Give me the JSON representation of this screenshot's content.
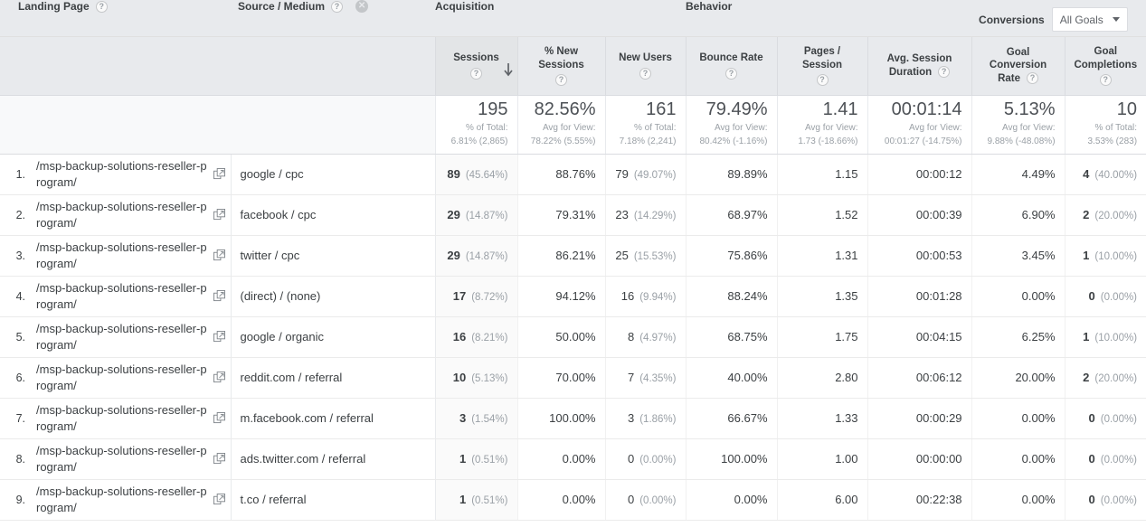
{
  "groups": {
    "acquisition": "Acquisition",
    "behavior": "Behavior",
    "conversions": "Conversions",
    "goals_select_value": "All Goals"
  },
  "dimensions": {
    "primary": "Landing Page",
    "secondary": "Source / Medium"
  },
  "metrics": {
    "sessions": "Sessions",
    "pct_new_sessions": "% New Sessions",
    "new_users": "New Users",
    "bounce_rate": "Bounce Rate",
    "pages_per_session": "Pages / Session",
    "avg_session_duration_l1": "Avg. Session",
    "avg_session_duration_l2": "Duration",
    "goal_conversion_rate_l1": "Goal Conversion",
    "goal_conversion_rate_l2": "Rate",
    "goal_completions_l1": "Goal",
    "goal_completions_l2": "Completions"
  },
  "icons": {
    "help": "?",
    "remove_secondary_dimension": "✕",
    "sort_descending": "sort-descending-arrow",
    "open_in_new": "open-in-new-window"
  },
  "totals": {
    "sessions": {
      "value": "195",
      "sub1": "% of Total:",
      "sub2": "6.81% (2,865)"
    },
    "pct_new": {
      "value": "82.56%",
      "sub1": "Avg for View:",
      "sub2": "78.22% (5.55%)"
    },
    "new_users": {
      "value": "161",
      "sub1": "% of Total:",
      "sub2": "7.18% (2,241)"
    },
    "bounce": {
      "value": "79.49%",
      "sub1": "Avg for View:",
      "sub2": "80.42% (-1.16%)"
    },
    "pages": {
      "value": "1.41",
      "sub1": "Avg for View:",
      "sub2": "1.73 (-18.66%)"
    },
    "duration": {
      "value": "00:01:14",
      "sub1": "Avg for View:",
      "sub2": "00:01:27 (-14.75%)"
    },
    "goal_rate": {
      "value": "5.13%",
      "sub1": "Avg for View:",
      "sub2": "9.88% (-48.08%)"
    },
    "goal_compl": {
      "value": "10",
      "sub1": "% of Total:",
      "sub2": "3.53% (283)"
    }
  },
  "rows": [
    {
      "index": "1.",
      "landing_page": "/msp-backup-solutions-reseller-program/",
      "source_medium": "google / cpc",
      "sessions": "89",
      "sessions_pct": "(45.64%)",
      "pct_new_sessions": "88.76%",
      "new_users": "79",
      "new_users_pct": "(49.07%)",
      "bounce_rate": "89.89%",
      "pages_per_session": "1.15",
      "avg_session_duration": "00:00:12",
      "goal_conversion_rate": "4.49%",
      "goal_completions": "4",
      "goal_completions_pct": "(40.00%)"
    },
    {
      "index": "2.",
      "landing_page": "/msp-backup-solutions-reseller-program/",
      "source_medium": "facebook / cpc",
      "sessions": "29",
      "sessions_pct": "(14.87%)",
      "pct_new_sessions": "79.31%",
      "new_users": "23",
      "new_users_pct": "(14.29%)",
      "bounce_rate": "68.97%",
      "pages_per_session": "1.52",
      "avg_session_duration": "00:00:39",
      "goal_conversion_rate": "6.90%",
      "goal_completions": "2",
      "goal_completions_pct": "(20.00%)"
    },
    {
      "index": "3.",
      "landing_page": "/msp-backup-solutions-reseller-program/",
      "source_medium": "twitter / cpc",
      "sessions": "29",
      "sessions_pct": "(14.87%)",
      "pct_new_sessions": "86.21%",
      "new_users": "25",
      "new_users_pct": "(15.53%)",
      "bounce_rate": "75.86%",
      "pages_per_session": "1.31",
      "avg_session_duration": "00:00:53",
      "goal_conversion_rate": "3.45%",
      "goal_completions": "1",
      "goal_completions_pct": "(10.00%)"
    },
    {
      "index": "4.",
      "landing_page": "/msp-backup-solutions-reseller-program/",
      "source_medium": "(direct) / (none)",
      "sessions": "17",
      "sessions_pct": "(8.72%)",
      "pct_new_sessions": "94.12%",
      "new_users": "16",
      "new_users_pct": "(9.94%)",
      "bounce_rate": "88.24%",
      "pages_per_session": "1.35",
      "avg_session_duration": "00:01:28",
      "goal_conversion_rate": "0.00%",
      "goal_completions": "0",
      "goal_completions_pct": "(0.00%)"
    },
    {
      "index": "5.",
      "landing_page": "/msp-backup-solutions-reseller-program/",
      "source_medium": "google / organic",
      "sessions": "16",
      "sessions_pct": "(8.21%)",
      "pct_new_sessions": "50.00%",
      "new_users": "8",
      "new_users_pct": "(4.97%)",
      "bounce_rate": "68.75%",
      "pages_per_session": "1.75",
      "avg_session_duration": "00:04:15",
      "goal_conversion_rate": "6.25%",
      "goal_completions": "1",
      "goal_completions_pct": "(10.00%)"
    },
    {
      "index": "6.",
      "landing_page": "/msp-backup-solutions-reseller-program/",
      "source_medium": "reddit.com / referral",
      "sessions": "10",
      "sessions_pct": "(5.13%)",
      "pct_new_sessions": "70.00%",
      "new_users": "7",
      "new_users_pct": "(4.35%)",
      "bounce_rate": "40.00%",
      "pages_per_session": "2.80",
      "avg_session_duration": "00:06:12",
      "goal_conversion_rate": "20.00%",
      "goal_completions": "2",
      "goal_completions_pct": "(20.00%)"
    },
    {
      "index": "7.",
      "landing_page": "/msp-backup-solutions-reseller-program/",
      "source_medium": "m.facebook.com / referral",
      "sessions": "3",
      "sessions_pct": "(1.54%)",
      "pct_new_sessions": "100.00%",
      "new_users": "3",
      "new_users_pct": "(1.86%)",
      "bounce_rate": "66.67%",
      "pages_per_session": "1.33",
      "avg_session_duration": "00:00:29",
      "goal_conversion_rate": "0.00%",
      "goal_completions": "0",
      "goal_completions_pct": "(0.00%)"
    },
    {
      "index": "8.",
      "landing_page": "/msp-backup-solutions-reseller-program/",
      "source_medium": "ads.twitter.com / referral",
      "sessions": "1",
      "sessions_pct": "(0.51%)",
      "pct_new_sessions": "0.00%",
      "new_users": "0",
      "new_users_pct": "(0.00%)",
      "bounce_rate": "100.00%",
      "pages_per_session": "1.00",
      "avg_session_duration": "00:00:00",
      "goal_conversion_rate": "0.00%",
      "goal_completions": "0",
      "goal_completions_pct": "(0.00%)"
    },
    {
      "index": "9.",
      "landing_page": "/msp-backup-solutions-reseller-program/",
      "source_medium": "t.co / referral",
      "sessions": "1",
      "sessions_pct": "(0.51%)",
      "pct_new_sessions": "0.00%",
      "new_users": "0",
      "new_users_pct": "(0.00%)",
      "bounce_rate": "0.00%",
      "pages_per_session": "6.00",
      "avg_session_duration": "00:22:38",
      "goal_conversion_rate": "0.00%",
      "goal_completions": "0",
      "goal_completions_pct": "(0.00%)"
    }
  ],
  "chart_data": {
    "type": "table",
    "title": "Landing Pages with Source / Medium secondary dimension",
    "columns": [
      "Landing Page",
      "Source / Medium",
      "Sessions",
      "% New Sessions",
      "New Users",
      "Bounce Rate",
      "Pages / Session",
      "Avg. Session Duration",
      "Goal Conversion Rate",
      "Goal Completions"
    ],
    "rows": [
      [
        "/msp-backup-solutions-reseller-program/",
        "google / cpc",
        89,
        88.76,
        79,
        89.89,
        1.15,
        "00:00:12",
        4.49,
        4
      ],
      [
        "/msp-backup-solutions-reseller-program/",
        "facebook / cpc",
        29,
        79.31,
        23,
        68.97,
        1.52,
        "00:00:39",
        6.9,
        2
      ],
      [
        "/msp-backup-solutions-reseller-program/",
        "twitter / cpc",
        29,
        86.21,
        25,
        75.86,
        1.31,
        "00:00:53",
        3.45,
        1
      ],
      [
        "/msp-backup-solutions-reseller-program/",
        "(direct) / (none)",
        17,
        94.12,
        16,
        88.24,
        1.35,
        "00:01:28",
        0.0,
        0
      ],
      [
        "/msp-backup-solutions-reseller-program/",
        "google / organic",
        16,
        50.0,
        8,
        68.75,
        1.75,
        "00:04:15",
        6.25,
        1
      ],
      [
        "/msp-backup-solutions-reseller-program/",
        "reddit.com / referral",
        10,
        70.0,
        7,
        40.0,
        2.8,
        "00:06:12",
        20.0,
        2
      ],
      [
        "/msp-backup-solutions-reseller-program/",
        "m.facebook.com / referral",
        3,
        100.0,
        3,
        66.67,
        1.33,
        "00:00:29",
        0.0,
        0
      ],
      [
        "/msp-backup-solutions-reseller-program/",
        "ads.twitter.com / referral",
        1,
        0.0,
        0,
        100.0,
        1.0,
        "00:00:00",
        0.0,
        0
      ],
      [
        "/msp-backup-solutions-reseller-program/",
        "t.co / referral",
        1,
        0.0,
        0,
        0.0,
        6.0,
        "00:22:38",
        0.0,
        0
      ]
    ],
    "totals": [
      195,
      82.56,
      161,
      79.49,
      1.41,
      "00:01:14",
      5.13,
      10
    ],
    "sorted_by": "Sessions",
    "sort_direction": "descending"
  }
}
